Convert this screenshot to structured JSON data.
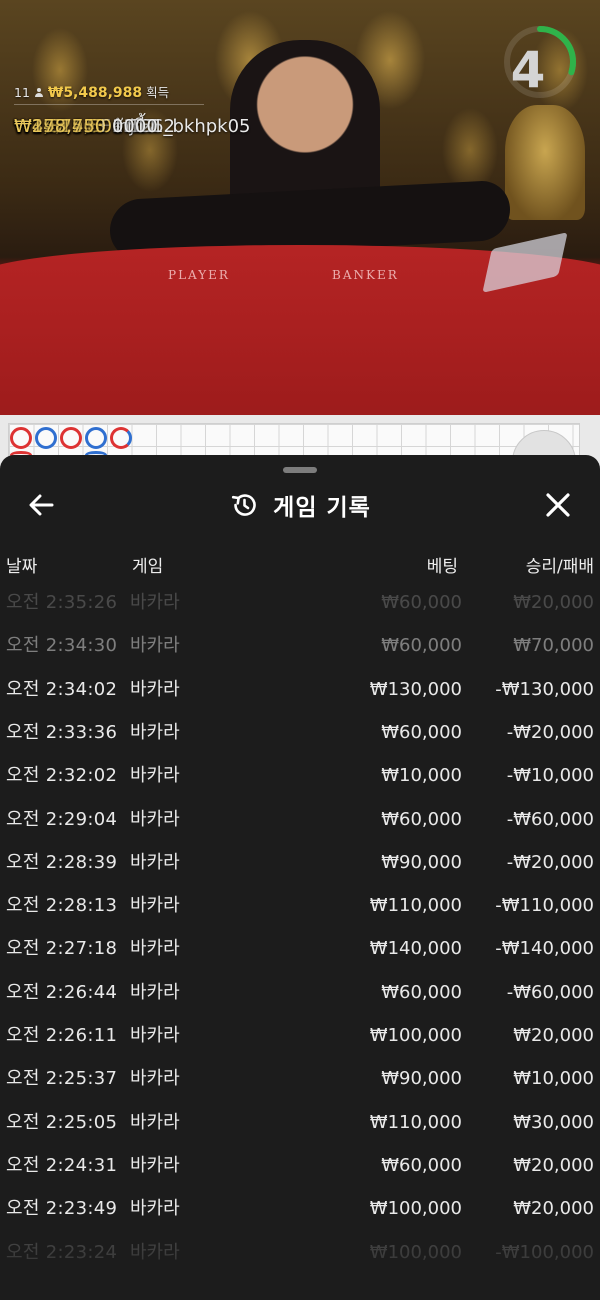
{
  "live": {
    "timer_value": "4",
    "timer_progress": 0.3,
    "table_labels": {
      "player": "PLAYER",
      "banker": "BANKER"
    },
    "winners_summary": {
      "count": "11",
      "amount": "₩5,488,988",
      "suffix": "획득"
    },
    "winners": [
      {
        "amount": "₩2,372,500",
        "name": "556_bkhpk05"
      },
      {
        "amount": "₩1,816,500",
        "name": "1212"
      },
      {
        "amount": "₩420,915",
        "name": "ลักกี้"
      },
      {
        "amount": "₩347,500",
        "name": "mj07"
      },
      {
        "amount": "₩295,433",
        "name": "1111"
      },
      {
        "amount": "₩178,750",
        "name": "0000"
      },
      {
        "amount": "₩25,254",
        "name": "F"
      }
    ]
  },
  "history": {
    "title": "게임 기록",
    "columns": {
      "date": "날짜",
      "game": "게임",
      "bet": "베팅",
      "result": "승리/패배"
    },
    "rows": [
      {
        "date": "오전 2:35:26",
        "game": "바카라",
        "bet": "₩60,000",
        "result": "₩20,000"
      },
      {
        "date": "오전 2:34:30",
        "game": "바카라",
        "bet": "₩60,000",
        "result": "₩70,000"
      },
      {
        "date": "오전 2:34:02",
        "game": "바카라",
        "bet": "₩130,000",
        "result": "-₩130,000"
      },
      {
        "date": "오전 2:33:36",
        "game": "바카라",
        "bet": "₩60,000",
        "result": "-₩20,000"
      },
      {
        "date": "오전 2:32:02",
        "game": "바카라",
        "bet": "₩10,000",
        "result": "-₩10,000"
      },
      {
        "date": "오전 2:29:04",
        "game": "바카라",
        "bet": "₩60,000",
        "result": "-₩60,000"
      },
      {
        "date": "오전 2:28:39",
        "game": "바카라",
        "bet": "₩90,000",
        "result": "-₩20,000"
      },
      {
        "date": "오전 2:28:13",
        "game": "바카라",
        "bet": "₩110,000",
        "result": "-₩110,000"
      },
      {
        "date": "오전 2:27:18",
        "game": "바카라",
        "bet": "₩140,000",
        "result": "-₩140,000"
      },
      {
        "date": "오전 2:26:44",
        "game": "바카라",
        "bet": "₩60,000",
        "result": "-₩60,000"
      },
      {
        "date": "오전 2:26:11",
        "game": "바카라",
        "bet": "₩100,000",
        "result": "₩20,000"
      },
      {
        "date": "오전 2:25:37",
        "game": "바카라",
        "bet": "₩90,000",
        "result": "₩10,000"
      },
      {
        "date": "오전 2:25:05",
        "game": "바카라",
        "bet": "₩110,000",
        "result": "₩30,000"
      },
      {
        "date": "오전 2:24:31",
        "game": "바카라",
        "bet": "₩60,000",
        "result": "₩20,000"
      },
      {
        "date": "오전 2:23:49",
        "game": "바카라",
        "bet": "₩100,000",
        "result": "₩20,000"
      },
      {
        "date": "오전 2:23:24",
        "game": "바카라",
        "bet": "₩100,000",
        "result": "-₩100,000"
      }
    ]
  },
  "icons": {
    "back": "arrow-left-icon",
    "close": "close-icon",
    "history": "history-icon",
    "winners": "person-icon"
  },
  "colors": {
    "sheet_bg": "#1c1c1c",
    "winner_amount": "#f2c94c",
    "banker_red": "#dd3333",
    "player_blue": "#2f6fd0",
    "timer_green": "#2fb34a"
  }
}
